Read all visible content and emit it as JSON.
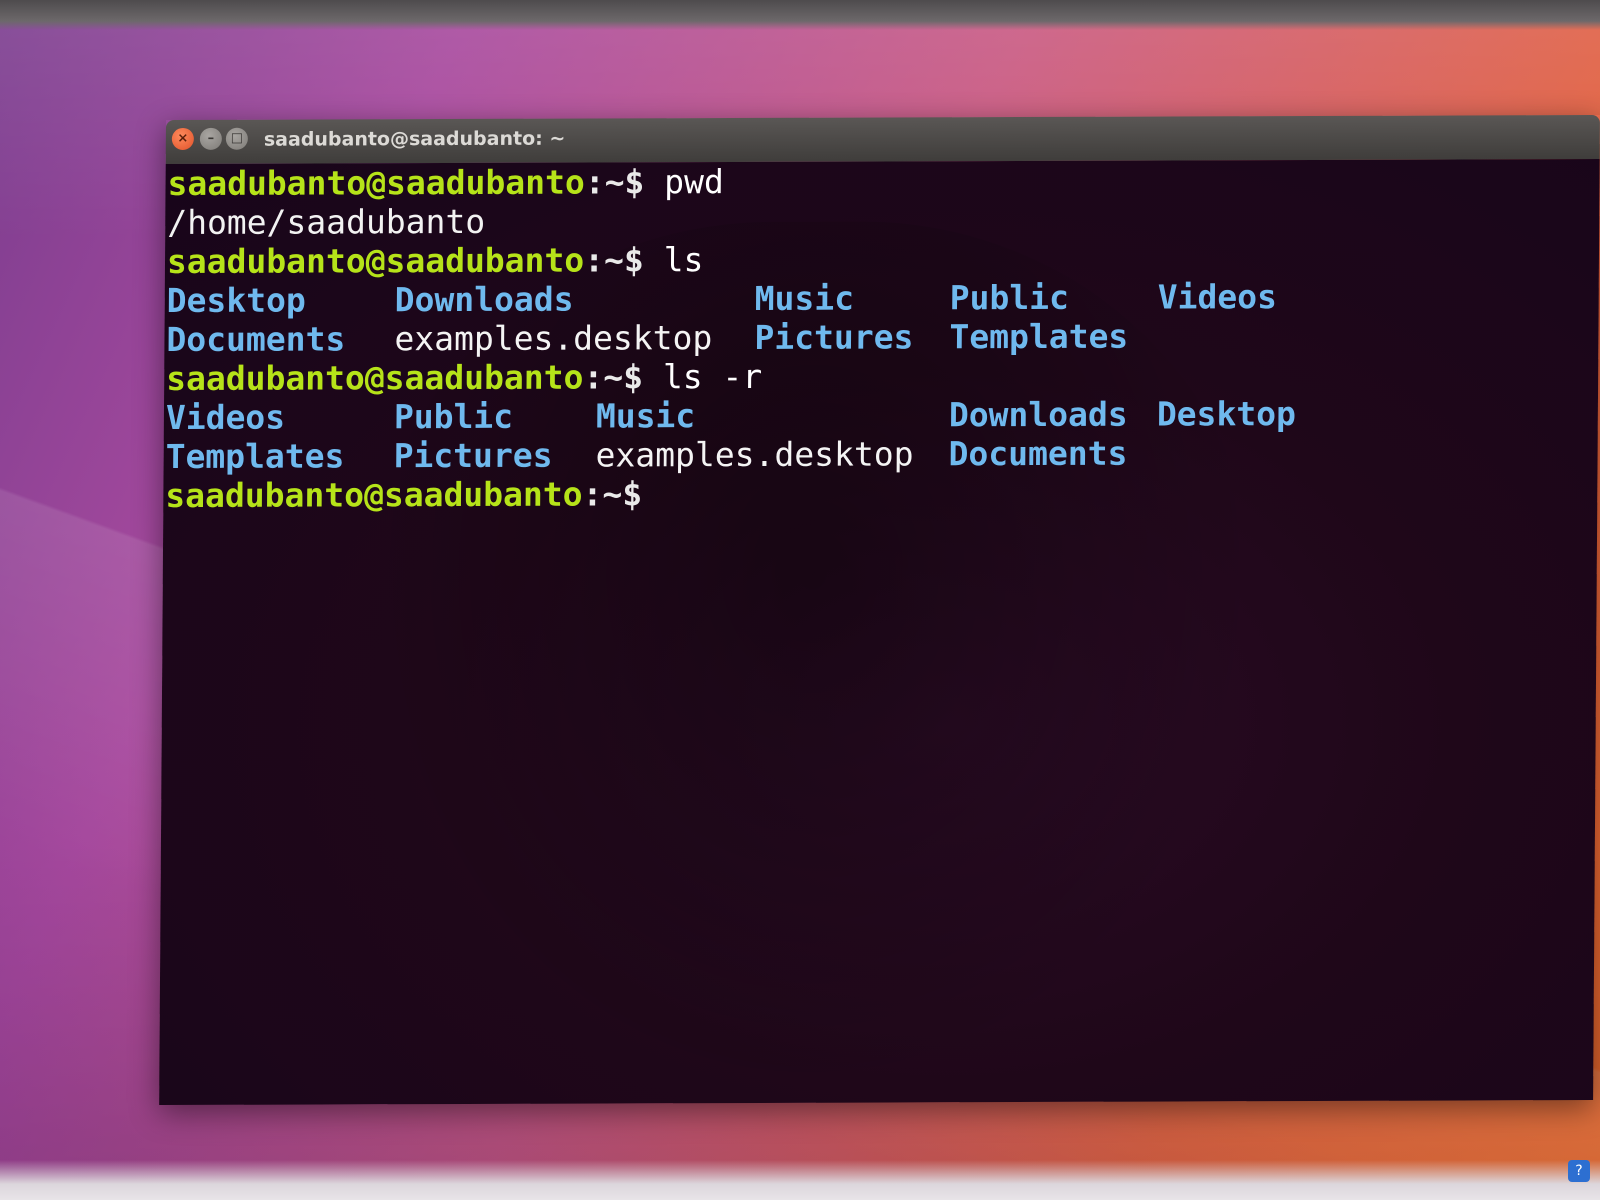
{
  "window": {
    "title": "saadubanto@saadubanto: ~",
    "close_glyph": "×",
    "min_glyph": "–",
    "max_glyph": "□"
  },
  "colors": {
    "prompt": "#b6e319",
    "directory": "#6fb9ee",
    "text": "#f2f2f2",
    "background": "#1f0719"
  },
  "terminal": {
    "prompt_user": "saadubanto@saadubanto",
    "prompt_suffix": ":~$",
    "commands": [
      {
        "cmd": "pwd"
      },
      {
        "cmd": "ls"
      },
      {
        "cmd": "ls -r"
      }
    ],
    "pwd_output": "/home/saadubanto",
    "ls_output": {
      "row1": [
        "Desktop",
        "Downloads",
        "Music",
        "Public",
        "Videos"
      ],
      "row2": [
        "Documents",
        "examples.desktop",
        "Pictures",
        "Templates"
      ]
    },
    "ls_r_output": {
      "row1": [
        "Videos",
        "Public",
        "Music",
        "Downloads",
        "Desktop"
      ],
      "row2": [
        "Templates",
        "Pictures",
        "examples.desktop",
        "Documents"
      ]
    }
  },
  "tray": {
    "icon": "help-icon",
    "glyph": "?"
  }
}
